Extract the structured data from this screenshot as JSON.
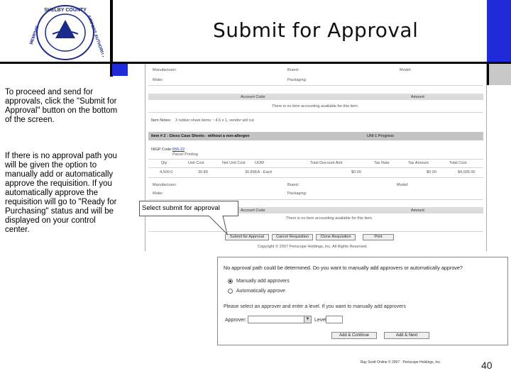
{
  "slide": {
    "title": "Submit for Approval",
    "page_number": "40",
    "footer": "Ray Scott Online © 2007 · Periscope Holdings, Inc."
  },
  "logo": {
    "text_top": "SHELBY COUNTY",
    "text_right": "AIRPORT AUTHORITY",
    "text_left": "MEMPHIS"
  },
  "instructions": {
    "paragraph1": "To proceed and send for approvals, click the \"Submit for Approval\" button on the bottom of the screen.",
    "paragraph2": "If there is no approval path you will be given the option to manually add or automatically approve the requisition.  If you automatically approve the requisition will go to \"Ready for Purchasing\" status and will be displayed on your control center."
  },
  "callout": {
    "label": "Select submit for approval"
  },
  "requisition": {
    "top_labels": {
      "manufacturer": "Manufacturer:",
      "brand": "Brand:",
      "model": "Model:",
      "make": "Make:",
      "packaging": "Packaging:"
    },
    "account_code": "Account Code",
    "amount": "Amount",
    "no_accounting": "There is no item accounting available for this item.",
    "item_notes_label": "Item Notes:",
    "item_notes": "3 rubber sheet items ~ 4.5 x 1, vendor will cut",
    "item2_title": "Item # 2 :  Gloss Case Sheets - without a non-allergen",
    "item2_status": "UNI-1  Progress",
    "nigp_label": "NIGP Code:",
    "nigp_value": "655-22",
    "nigp_desc": "Parcel Printing",
    "columns": [
      "Qty",
      "Unit Cost",
      "Net Unit Cost",
      "UOM",
      "Total Discount Amt",
      "Tax Rate",
      "Tax Amount",
      "Total Cost"
    ],
    "row": [
      "4,500.0",
      "30.89",
      "30.89",
      "EA - Each",
      "$0.00",
      "",
      "$0.00",
      "$4,005.00"
    ],
    "copyright": "Copyright © 2007 Periscope Holdings, Inc. All Rights Reserved.",
    "buttons": {
      "submit": "Submit for Approval",
      "cancel": "Cancel Requisition",
      "clone": "Clone Requisition",
      "print": "Print"
    }
  },
  "dialog": {
    "question": "No approval path could be determined.  Do you want to manually add approvers or automatically approve?",
    "option_manual": "Manually add approvers",
    "option_auto": "Automatically approve",
    "select_prompt": "Please select an approver and enter a level. If you want to manually add approvers",
    "approver_label": "Approver:",
    "level_label": "Level:",
    "button_continue": "Add & Continue",
    "button_next": "Add & Next"
  },
  "colors": {
    "accent_blue": "#1f2bd8",
    "bar_black": "#000000"
  }
}
